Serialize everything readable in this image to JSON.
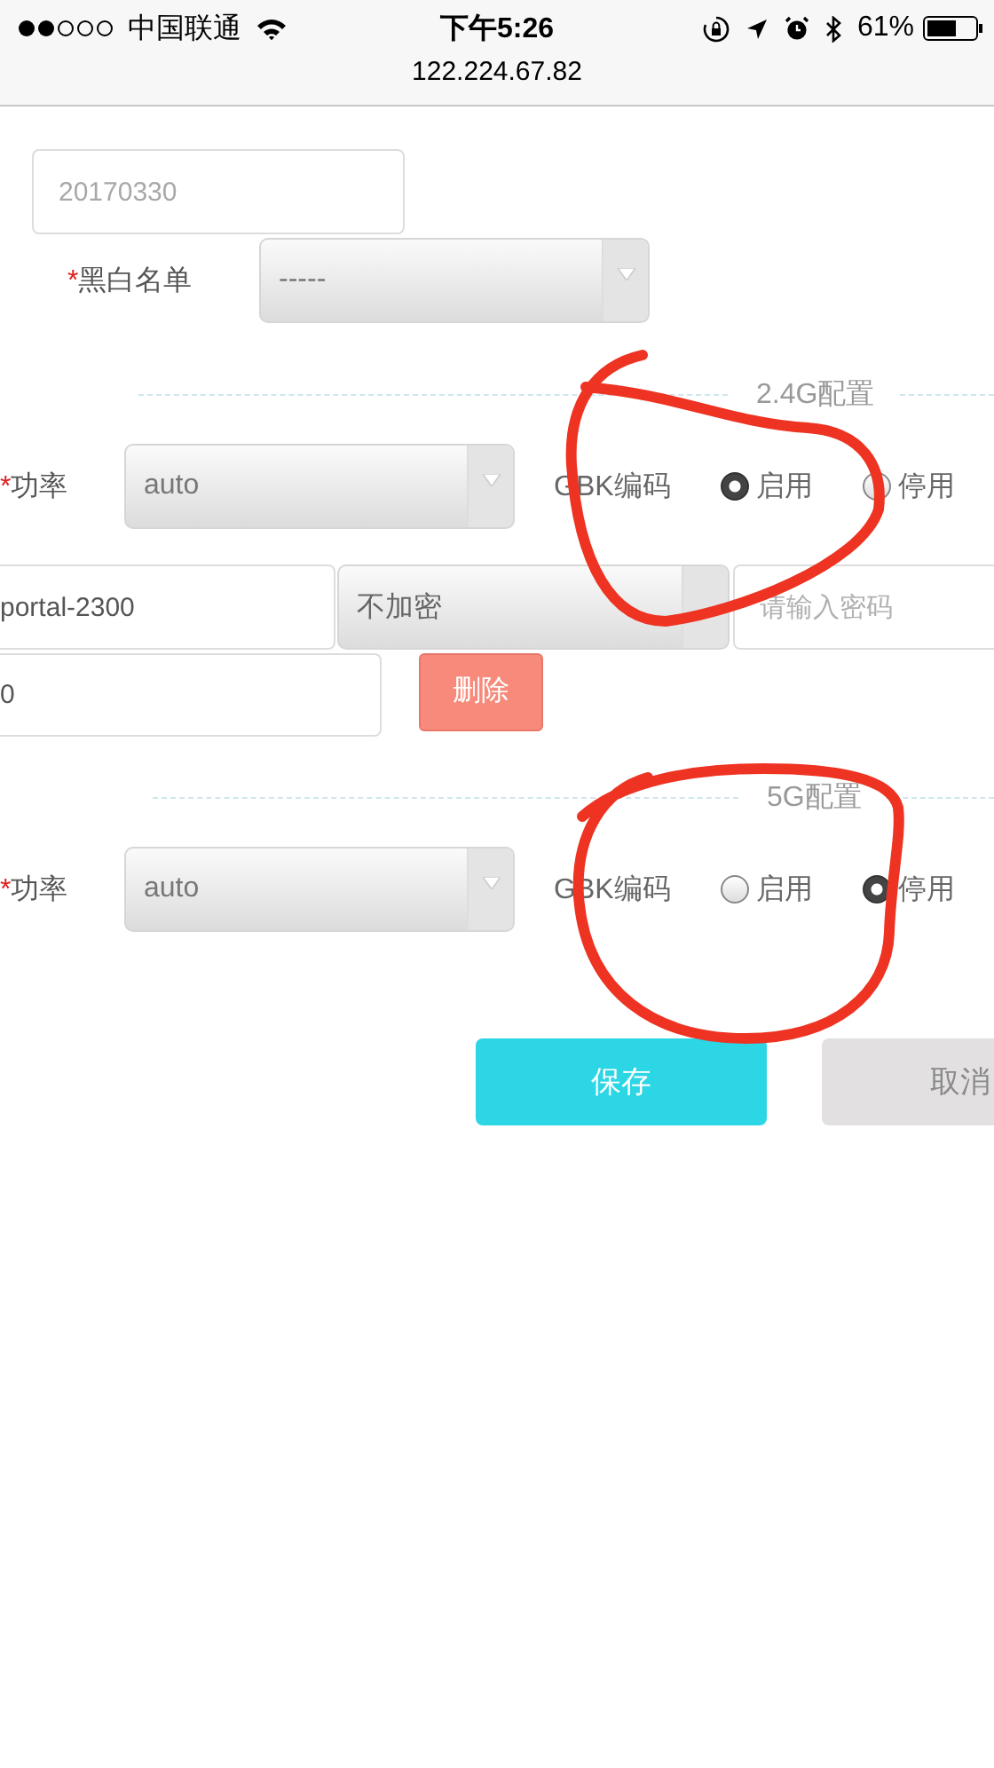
{
  "status_bar": {
    "carrier": "中国联通",
    "time": "下午5:26",
    "battery": "61%"
  },
  "address_bar": {
    "url": "122.224.67.82"
  },
  "date_field": {
    "placeholder": "20170330"
  },
  "blacklist": {
    "required_mark": "*",
    "label": "黑白名单",
    "value": "-----"
  },
  "sections": [
    {
      "title": "2.4G配置",
      "power": {
        "required_mark": "*",
        "label": "功率",
        "value": "auto"
      },
      "gbk": {
        "label": "GBK编码",
        "options": [
          {
            "label": "启用",
            "selected": true
          },
          {
            "label": "停用",
            "selected": false
          }
        ]
      },
      "ssid": {
        "name": "portal-2300",
        "encryption": "不加密",
        "password_placeholder": "请输入密码",
        "field_4": "0",
        "delete_button": "删除"
      }
    },
    {
      "title": "5G配置",
      "power": {
        "required_mark": "*",
        "label": "功率",
        "value": "auto"
      },
      "gbk": {
        "label": "GBK编码",
        "options": [
          {
            "label": "启用",
            "selected": false
          },
          {
            "label": "停用",
            "selected": true
          }
        ]
      }
    }
  ],
  "buttons": [
    {
      "label": "保存",
      "kind": "primary"
    },
    {
      "label": "取消",
      "kind": "secondary"
    }
  ]
}
